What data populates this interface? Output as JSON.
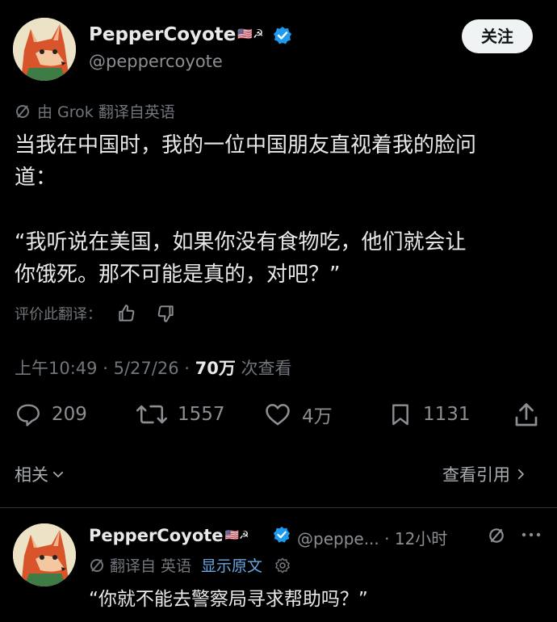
{
  "tweet": {
    "display_name": "PepperCoyote",
    "name_emoji": "🇺🇸☭",
    "handle": "@peppercoyote",
    "follow_label": "关注",
    "translation_note": "由 Grok 翻译自英语",
    "text_line1": "当我在中国时，我的一位中国朋友直视着我的脸问",
    "text_line2": "道：",
    "text_line3": "“我听说在美国，如果你没有食物吃，他们就会让",
    "text_line4": "你饿死。那不可能是真的，对吧？”",
    "rate_translation": "评价此翻译：",
    "time": "上午10:49",
    "sep": "·",
    "date": "5/27/26",
    "views_count": "70万",
    "views_label": "次查看",
    "stats": {
      "replies": "209",
      "retweets": "1557",
      "likes": "4万",
      "bookmarks": "1131"
    },
    "related_label": "相关",
    "view_quotes_label": "查看引用"
  },
  "reply": {
    "display_name": "PepperCoyote",
    "name_emoji": "🇺🇸☭",
    "handle_truncated": "@peppe...",
    "time_ago": "12小时",
    "translated_from": "翻译自 英语",
    "show_original": "显示原文",
    "text": "“你就不能去警察局寻求帮助吗？”"
  },
  "colors": {
    "background": "#000000",
    "text": "#e7e9ea",
    "muted": "#71767b",
    "verified": "#1d9bf0",
    "link": "#6aa7e0"
  }
}
